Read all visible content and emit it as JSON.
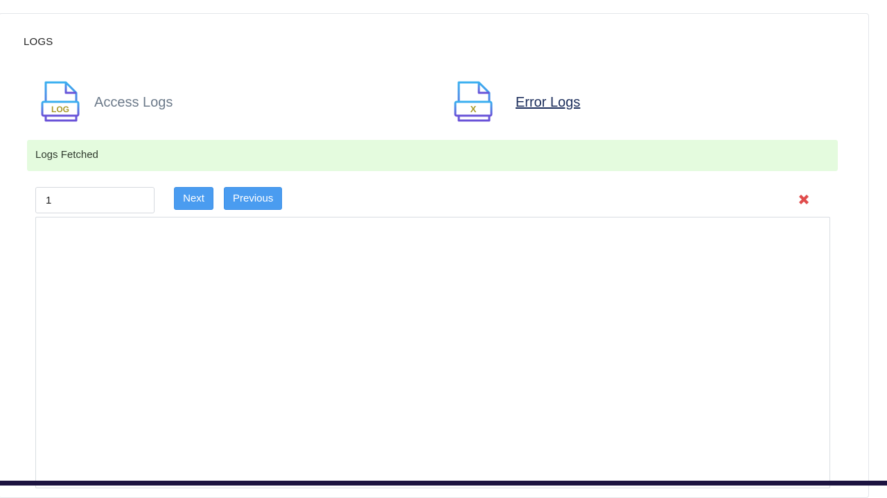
{
  "page": {
    "section_title": "LOGS"
  },
  "tabs": {
    "access": {
      "label": "Access Logs",
      "icon": "log-file-icon",
      "icon_text": "LOG"
    },
    "error": {
      "label": "Error Logs",
      "icon": "error-file-icon",
      "icon_text": "X"
    }
  },
  "alert": {
    "message": "Logs Fetched",
    "background": "#e4fbde"
  },
  "pagination": {
    "page_value": "1",
    "next_label": "Next",
    "previous_label": "Previous"
  },
  "actions": {
    "clear_icon": "close-icon",
    "clear_color": "#e04c4c"
  },
  "log_output": {
    "content": ""
  },
  "colors": {
    "button": "#4a9cf0",
    "link": "#1b2d5b"
  }
}
